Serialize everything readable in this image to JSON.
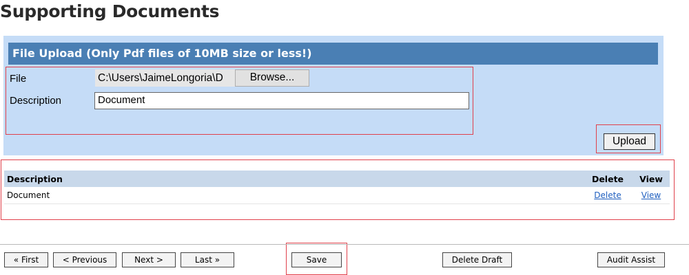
{
  "page": {
    "title": "Supporting Documents"
  },
  "upload": {
    "header": "File Upload (Only Pdf files of 10MB size or less!)",
    "file_label": "File",
    "file_value": "C:\\Users\\JaimeLongoria\\D",
    "browse_label": "Browse...",
    "description_label": "Description",
    "description_value": "Document",
    "upload_label": "Upload"
  },
  "documents": {
    "columns": {
      "description": "Description",
      "delete": "Delete",
      "view": "View"
    },
    "rows": [
      {
        "description": "Document",
        "delete": "Delete",
        "view": "View"
      }
    ]
  },
  "nav": {
    "first": "« First",
    "previous": "< Previous",
    "next": "Next >",
    "last": "Last »",
    "save": "Save",
    "delete_draft": "Delete Draft",
    "audit_assist": "Audit Assist"
  },
  "colors": {
    "panel_bg": "#c5dcf7",
    "header_bg": "#4a7fb4",
    "highlight_border": "#e0404a",
    "link": "#1f5fbf"
  }
}
